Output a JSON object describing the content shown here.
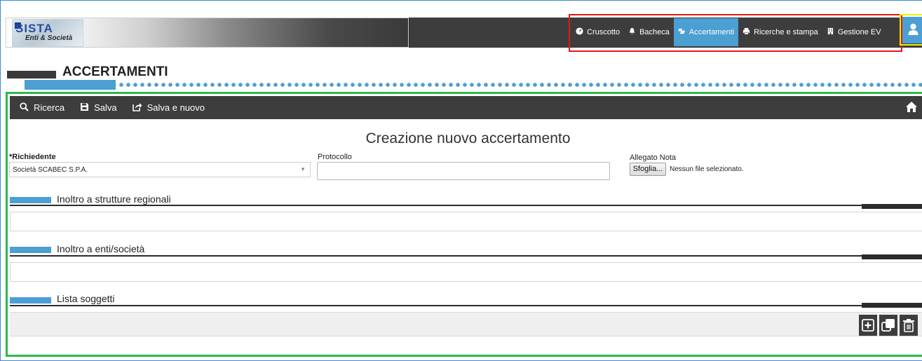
{
  "app": {
    "logo_text": "SISTA",
    "logo_subtitle": "Enti & Società"
  },
  "nav": {
    "items": [
      {
        "label": "Cruscotto",
        "icon": "dashboard-icon"
      },
      {
        "label": "Bacheca",
        "icon": "bell-icon"
      },
      {
        "label": "Accertamenti",
        "icon": "assessment-icon",
        "active": true
      },
      {
        "label": "Ricerche e stampa",
        "icon": "print-icon"
      },
      {
        "label": "Gestione EV",
        "icon": "building-icon"
      }
    ],
    "user_icon": "user-icon"
  },
  "page": {
    "title": "ACCERTAMENTI"
  },
  "toolbar": {
    "search_label": "Ricerca",
    "save_label": "Salva",
    "save_new_label": "Salva e nuovo",
    "home_icon": "home-icon"
  },
  "form": {
    "title": "Creazione nuovo accertamento",
    "requester_label": "*Richiedente",
    "requester_value": "Società SCABEC S.P.A.",
    "protocol_label": "Protocollo",
    "protocol_value": "",
    "attachment_label": "Allegato Nota",
    "browse_label": "Sfoglia...",
    "no_file_label": "Nessun file selezionato."
  },
  "sections": {
    "regional": "Inoltro a strutture regionali",
    "entities": "Inoltro a enti/società",
    "subjects": "Lista soggetti"
  },
  "list_actions": [
    "add-icon",
    "duplicate-icon",
    "delete-icon"
  ],
  "colors": {
    "accent": "#4b9fd2",
    "dark": "#3d3d3d",
    "highlight_red": "#e01818",
    "highlight_yellow": "#f0f000",
    "highlight_green": "#2db84a"
  }
}
